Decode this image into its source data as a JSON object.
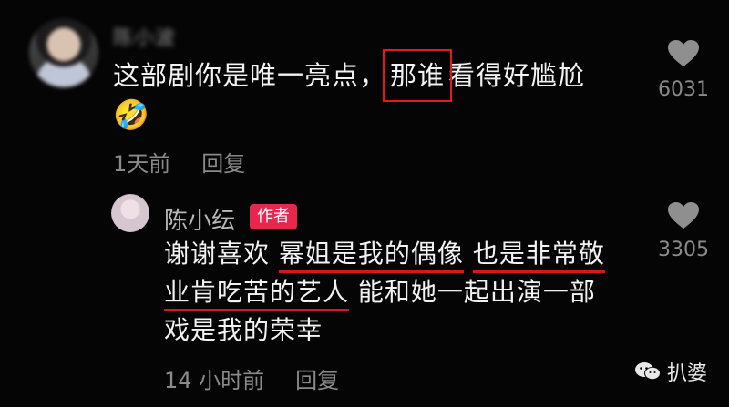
{
  "comment": {
    "username": "陈小波",
    "text_before": "这部剧你是唯一亮点，",
    "text_boxed": "那谁",
    "text_after": "看得好尴尬",
    "emoji": "🤣",
    "time": "1天前",
    "reply_label": "回复",
    "likes": "6031"
  },
  "reply": {
    "username": "陈小纭",
    "badge": "作者",
    "line1_a": "谢谢喜欢 ",
    "line1_b": "幂姐是我的偶像",
    "line1_c": " ",
    "line1_d": "也是非常敬",
    "line2_a": "业肯吃苦的艺人",
    "line2_b": " 能和她一起出演一部",
    "line3": "戏是我的荣幸",
    "time": "14 小时前",
    "reply_label": "回复",
    "likes": "3305"
  },
  "watermark": {
    "text": "扒婆",
    "icon": "wechat-icon"
  },
  "colors": {
    "accent_red": "#e11b1b",
    "badge_bg": "#e8264e",
    "muted": "#8a8a8a"
  }
}
